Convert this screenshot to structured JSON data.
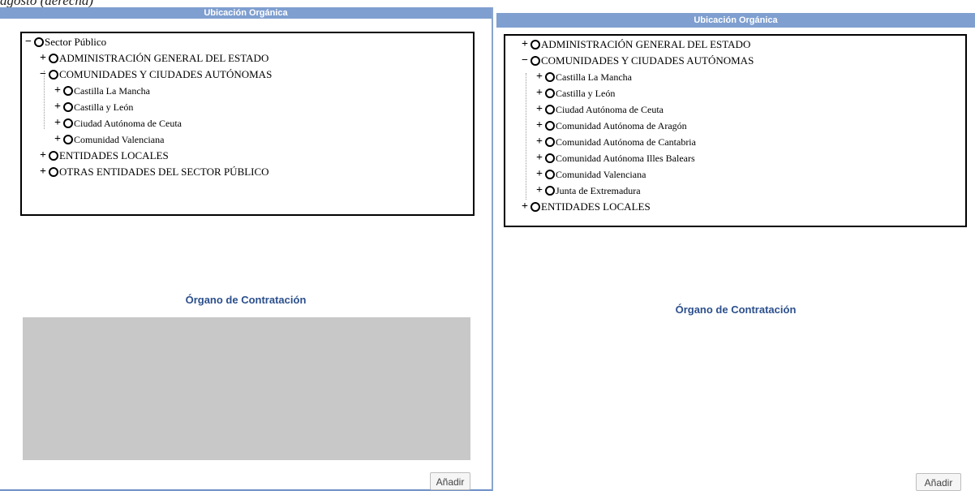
{
  "caption": "agosto (derecha)",
  "left_panel": {
    "header": "Ubicación Orgánica",
    "tree": [
      {
        "toggle": "−",
        "label": "Sector Público"
      },
      {
        "toggle": "+",
        "label": "ADMINISTRACIÓN GENERAL DEL ESTADO"
      },
      {
        "toggle": "−",
        "label": "COMUNIDADES Y CIUDADES AUTÓNOMAS"
      },
      {
        "toggle": "+",
        "label": "Castilla La Mancha"
      },
      {
        "toggle": "+",
        "label": "Castilla y León"
      },
      {
        "toggle": "+",
        "label": "Ciudad Autónoma de Ceuta"
      },
      {
        "toggle": "+",
        "label": "Comunidad Valenciana"
      },
      {
        "toggle": "+",
        "label": "ENTIDADES LOCALES"
      },
      {
        "toggle": "+",
        "label": "OTRAS ENTIDADES DEL SECTOR PÚBLICO"
      }
    ],
    "organo_title": "Órgano de Contratación",
    "add_button": "Añadir"
  },
  "right_panel": {
    "header": "Ubicación Orgánica",
    "tree": [
      {
        "toggle": "+",
        "label": "ADMINISTRACIÓN GENERAL DEL ESTADO"
      },
      {
        "toggle": "−",
        "label": "COMUNIDADES Y CIUDADES AUTÓNOMAS"
      },
      {
        "toggle": "+",
        "label": "Castilla La Mancha"
      },
      {
        "toggle": "+",
        "label": "Castilla y León"
      },
      {
        "toggle": "+",
        "label": "Ciudad Autónoma de Ceuta"
      },
      {
        "toggle": "+",
        "label": "Comunidad Autónoma de Aragón"
      },
      {
        "toggle": "+",
        "label": "Comunidad Autónoma de Cantabria"
      },
      {
        "toggle": "+",
        "label": "Comunidad Autónoma Illes Balears"
      },
      {
        "toggle": "+",
        "label": "Comunidad Valenciana"
      },
      {
        "toggle": "+",
        "label": "Junta de Extremadura"
      },
      {
        "toggle": "+",
        "label": "ENTIDADES LOCALES"
      }
    ],
    "organo_title": "Órgano de Contratación",
    "add_button": "Añadir"
  },
  "colors": {
    "header_bg": "#7f9fd0",
    "title_color": "#2b4f8c",
    "organo_box_bg": "#c8c8c8"
  }
}
